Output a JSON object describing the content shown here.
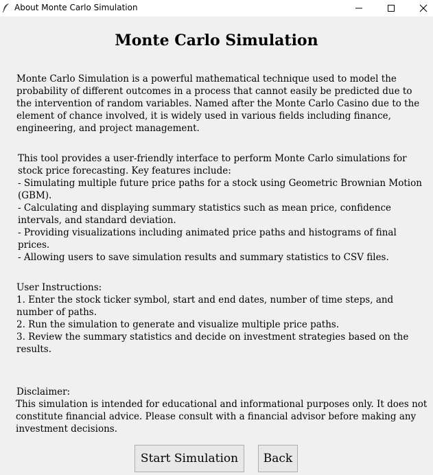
{
  "window": {
    "title": "About Monte Carlo Simulation",
    "icon": "feather-icon"
  },
  "controls": {
    "minimize_icon": "minimize-icon",
    "maximize_icon": "maximize-icon",
    "close_icon": "close-icon"
  },
  "content": {
    "heading": "Monte Carlo Simulation",
    "intro": "Monte Carlo Simulation is a powerful mathematical technique used to model the probability of different outcomes in a process that cannot easily be predicted due to the intervention of random variables. Named after the Monte Carlo Casino due to the element of chance involved, it is widely used in various fields including finance, engineering, and project management.",
    "features": "This tool provides a user-friendly interface to perform Monte Carlo simulations for stock price forecasting. Key features include:\n- Simulating multiple future price paths for a stock using Geometric Brownian Motion (GBM).\n- Calculating and displaying summary statistics such as mean price, confidence intervals, and standard deviation.\n- Providing visualizations including animated price paths and histograms of final prices.\n- Allowing users to save simulation results and summary statistics to CSV files.",
    "instructions": "User Instructions:\n1. Enter the stock ticker symbol, start and end dates, number of time steps, and number of paths.\n2. Run the simulation to generate and visualize multiple price paths.\n3. Review the summary statistics and decide on investment strategies based on the results.",
    "disclaimer_heading": "Disclaimer:",
    "disclaimer_body": "This simulation is intended for educational and informational purposes only. It does not constitute financial advice. Please consult with a financial advisor before making any investment decisions."
  },
  "buttons": {
    "start": "Start Simulation",
    "back": "Back"
  }
}
